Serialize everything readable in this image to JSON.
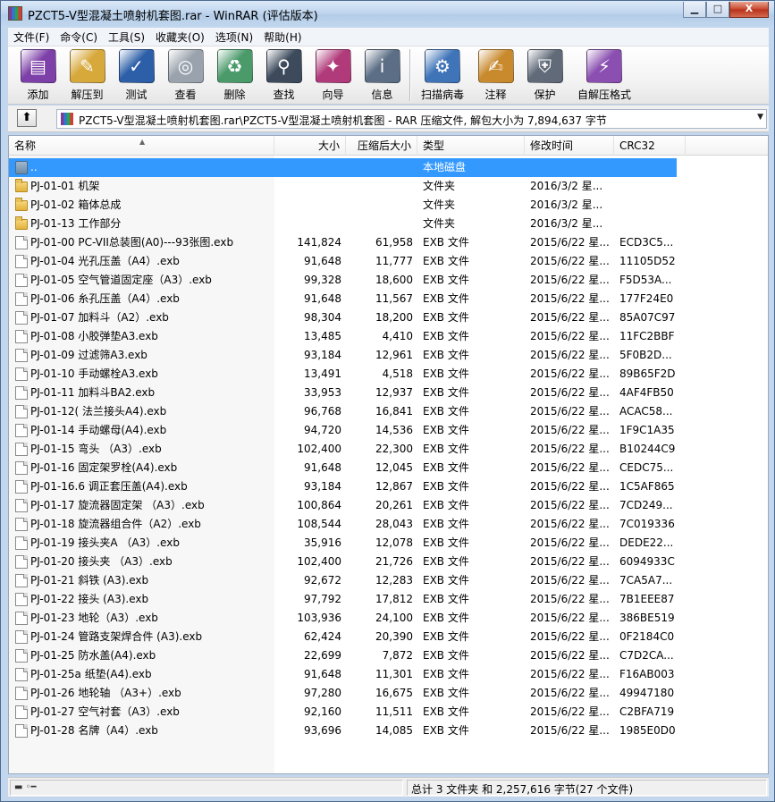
{
  "window": {
    "title": "PZCT5-V型混凝土喷射机套图.rar - WinRAR (评估版本)",
    "minimize": "▁",
    "maximize": "□",
    "close": "X"
  },
  "menu": [
    "文件(F)",
    "命令(C)",
    "工具(S)",
    "收藏夹(O)",
    "选项(N)",
    "帮助(H)"
  ],
  "toolbar": [
    {
      "label": "添加",
      "icon": "add-books-icon",
      "color": "#7d3fa8",
      "glyph": "▤"
    },
    {
      "label": "解压到",
      "icon": "extract-folder-icon",
      "color": "#d7a83a",
      "glyph": "✎"
    },
    {
      "label": "测试",
      "icon": "test-check-icon",
      "color": "#2d5fa8",
      "glyph": "✓"
    },
    {
      "label": "查看",
      "icon": "view-glasses-icon",
      "color": "#9aa3ad",
      "glyph": "◎"
    },
    {
      "label": "删除",
      "icon": "delete-bin-icon",
      "color": "#4a9a6a",
      "glyph": "♻"
    },
    {
      "label": "查找",
      "icon": "find-binoculars-icon",
      "color": "#3c4a5c",
      "glyph": "⚲"
    },
    {
      "label": "向导",
      "icon": "wizard-icon",
      "color": "#b03a7a",
      "glyph": "✦"
    },
    {
      "label": "信息",
      "icon": "info-icon",
      "color": "#5c6e85",
      "glyph": "i"
    },
    {
      "label": "扫描病毒",
      "icon": "virus-scan-icon",
      "color": "#3f74b8",
      "glyph": "⚙"
    },
    {
      "label": "注释",
      "icon": "comment-icon",
      "color": "#c98a2e",
      "glyph": "✍"
    },
    {
      "label": "保护",
      "icon": "protect-shield-icon",
      "color": "#606a78",
      "glyph": "⛨"
    },
    {
      "label": "自解压格式",
      "icon": "sfx-icon",
      "color": "#8a4fb0",
      "glyph": "⚡"
    }
  ],
  "pathbar": {
    "up_label": "⬆",
    "path": "PZCT5-V型混凝土喷射机套图.rar\\PZCT5-V型混凝土喷射机套图 - RAR 压缩文件, 解包大小为 7,894,637 字节"
  },
  "columns": {
    "name": "名称",
    "size": "大小",
    "packed": "压缩后大小",
    "type": "类型",
    "modified": "修改时间",
    "crc": "CRC32"
  },
  "rows": [
    {
      "kind": "drive",
      "name": "..",
      "size": "",
      "packed": "",
      "type": "本地磁盘",
      "modified": "",
      "crc": "",
      "selected": true
    },
    {
      "kind": "folder",
      "name": "PJ-01-01 机架",
      "size": "",
      "packed": "",
      "type": "文件夹",
      "modified": "2016/3/2 星...",
      "crc": ""
    },
    {
      "kind": "folder",
      "name": "PJ-01-02 箱体总成",
      "size": "",
      "packed": "",
      "type": "文件夹",
      "modified": "2016/3/2 星...",
      "crc": ""
    },
    {
      "kind": "folder",
      "name": "PJ-01-13 工作部分",
      "size": "",
      "packed": "",
      "type": "文件夹",
      "modified": "2016/3/2 星...",
      "crc": ""
    },
    {
      "kind": "file",
      "name": "PJ-01-00 PC-VII总装图(A0)---93张图.exb",
      "size": "141,824",
      "packed": "61,958",
      "type": "EXB 文件",
      "modified": "2015/6/22 星...",
      "crc": "ECD3C5..."
    },
    {
      "kind": "file",
      "name": "PJ-01-04 光孔压盖（A4）.exb",
      "size": "91,648",
      "packed": "11,777",
      "type": "EXB 文件",
      "modified": "2015/6/22 星...",
      "crc": "11105D52"
    },
    {
      "kind": "file",
      "name": "PJ-01-05 空气管道固定座（A3）.exb",
      "size": "99,328",
      "packed": "18,600",
      "type": "EXB 文件",
      "modified": "2015/6/22 星...",
      "crc": "F5D53A..."
    },
    {
      "kind": "file",
      "name": "PJ-01-06 糸孔压盖（A4）.exb",
      "size": "91,648",
      "packed": "11,567",
      "type": "EXB 文件",
      "modified": "2015/6/22 星...",
      "crc": "177F24E0"
    },
    {
      "kind": "file",
      "name": "PJ-01-07 加料斗（A2）.exb",
      "size": "98,304",
      "packed": "18,200",
      "type": "EXB 文件",
      "modified": "2015/6/22 星...",
      "crc": "85A07C97"
    },
    {
      "kind": "file",
      "name": "PJ-01-08 小胶弹垫A3.exb",
      "size": "13,485",
      "packed": "4,410",
      "type": "EXB 文件",
      "modified": "2015/6/22 星...",
      "crc": "11FC2BBF"
    },
    {
      "kind": "file",
      "name": "PJ-01-09 过滤筛A3.exb",
      "size": "93,184",
      "packed": "12,961",
      "type": "EXB 文件",
      "modified": "2015/6/22 星...",
      "crc": "5F0B2D..."
    },
    {
      "kind": "file",
      "name": "PJ-01-10 手动螺栓A3.exb",
      "size": "13,491",
      "packed": "4,518",
      "type": "EXB 文件",
      "modified": "2015/6/22 星...",
      "crc": "89B65F2D"
    },
    {
      "kind": "file",
      "name": "PJ-01-11 加料斗BA2.exb",
      "size": "33,953",
      "packed": "12,937",
      "type": "EXB 文件",
      "modified": "2015/6/22 星...",
      "crc": "4AF4FB50"
    },
    {
      "kind": "file",
      "name": "PJ-01-12( 法兰接头A4).exb",
      "size": "96,768",
      "packed": "16,841",
      "type": "EXB 文件",
      "modified": "2015/6/22 星...",
      "crc": "ACAC58..."
    },
    {
      "kind": "file",
      "name": "PJ-01-14 手动螺母(A4).exb",
      "size": "94,720",
      "packed": "14,536",
      "type": "EXB 文件",
      "modified": "2015/6/22 星...",
      "crc": "1F9C1A35"
    },
    {
      "kind": "file",
      "name": "PJ-01-15 弯头 （A3）.exb",
      "size": "102,400",
      "packed": "22,300",
      "type": "EXB 文件",
      "modified": "2015/6/22 星...",
      "crc": "B10244C9"
    },
    {
      "kind": "file",
      "name": "PJ-01-16 固定架罗栓(A4).exb",
      "size": "91,648",
      "packed": "12,045",
      "type": "EXB 文件",
      "modified": "2015/6/22 星...",
      "crc": "CEDC75..."
    },
    {
      "kind": "file",
      "name": "PJ-01-16.6 调正套压盖(A4).exb",
      "size": "93,184",
      "packed": "12,867",
      "type": "EXB 文件",
      "modified": "2015/6/22 星...",
      "crc": "1C5AF865"
    },
    {
      "kind": "file",
      "name": "PJ-01-17 旋流器固定架 （A3）.exb",
      "size": "100,864",
      "packed": "20,261",
      "type": "EXB 文件",
      "modified": "2015/6/22 星...",
      "crc": "7CD249..."
    },
    {
      "kind": "file",
      "name": "PJ-01-18 旋流器组合件（A2）.exb",
      "size": "108,544",
      "packed": "28,043",
      "type": "EXB 文件",
      "modified": "2015/6/22 星...",
      "crc": "7C019336"
    },
    {
      "kind": "file",
      "name": "PJ-01-19 接头夹A （A3）.exb",
      "size": "35,916",
      "packed": "12,078",
      "type": "EXB 文件",
      "modified": "2015/6/22 星...",
      "crc": "DEDE22..."
    },
    {
      "kind": "file",
      "name": "PJ-01-20 接头夹 （A3）.exb",
      "size": "102,400",
      "packed": "21,726",
      "type": "EXB 文件",
      "modified": "2015/6/22 星...",
      "crc": "6094933C"
    },
    {
      "kind": "file",
      "name": "PJ-01-21 斜铁 (A3).exb",
      "size": "92,672",
      "packed": "12,283",
      "type": "EXB 文件",
      "modified": "2015/6/22 星...",
      "crc": "7CA5A7..."
    },
    {
      "kind": "file",
      "name": "PJ-01-22 接头 (A3).exb",
      "size": "97,792",
      "packed": "17,812",
      "type": "EXB 文件",
      "modified": "2015/6/22 星...",
      "crc": "7B1EEE87"
    },
    {
      "kind": "file",
      "name": "PJ-01-23 地轮（A3）.exb",
      "size": "103,936",
      "packed": "24,100",
      "type": "EXB 文件",
      "modified": "2015/6/22 星...",
      "crc": "386BE519"
    },
    {
      "kind": "file",
      "name": "PJ-01-24 管路支架焊合件 (A3).exb",
      "size": "62,424",
      "packed": "20,390",
      "type": "EXB 文件",
      "modified": "2015/6/22 星...",
      "crc": "0F2184C0"
    },
    {
      "kind": "file",
      "name": "PJ-01-25 防水盖(A4).exb",
      "size": "22,699",
      "packed": "7,872",
      "type": "EXB 文件",
      "modified": "2015/6/22 星...",
      "crc": "C7D2CA..."
    },
    {
      "kind": "file",
      "name": "PJ-01-25a 纸垫(A4).exb",
      "size": "91,648",
      "packed": "11,301",
      "type": "EXB 文件",
      "modified": "2015/6/22 星...",
      "crc": "F16AB003"
    },
    {
      "kind": "file",
      "name": "PJ-01-26 地轮轴 （A3+）.exb",
      "size": "97,280",
      "packed": "16,675",
      "type": "EXB 文件",
      "modified": "2015/6/22 星...",
      "crc": "49947180"
    },
    {
      "kind": "file",
      "name": "PJ-01-27 空气衬套（A3）.exb",
      "size": "92,160",
      "packed": "11,511",
      "type": "EXB 文件",
      "modified": "2015/6/22 星...",
      "crc": "C2BFA719"
    },
    {
      "kind": "file",
      "name": "PJ-01-28 名牌（A4）.exb",
      "size": "93,696",
      "packed": "14,085",
      "type": "EXB 文件",
      "modified": "2015/6/22 星...",
      "crc": "1985E0D0"
    }
  ],
  "status": {
    "keys": "▬ ◦━",
    "summary": "总计 3 文件夹 和 2,257,616 字节(27 个文件)"
  },
  "colors": {
    "selection": "#3399ff",
    "frame": "#c2d7ee"
  }
}
